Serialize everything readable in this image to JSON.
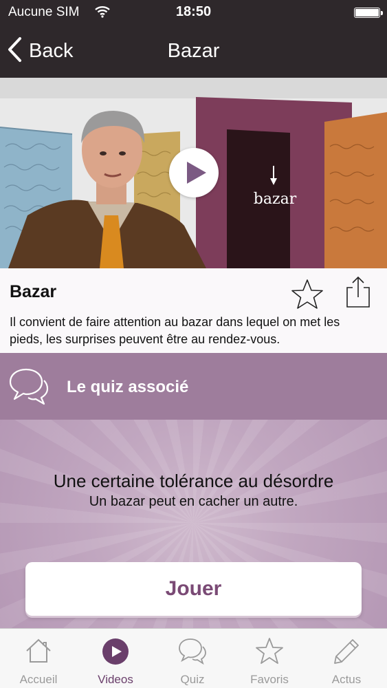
{
  "status": {
    "carrier": "Aucune SIM",
    "time": "18:50"
  },
  "nav": {
    "back_label": "Back",
    "title": "Bazar"
  },
  "video": {
    "overlay_word": "bazar"
  },
  "info": {
    "title": "Bazar",
    "description": "Il convient de faire attention au bazar dans lequel on met les pieds, les surprises peuvent être au rendez-vous."
  },
  "quiz": {
    "header_label": "Le quiz associé",
    "title": "Une certaine tolérance au désordre",
    "subtitle": "Un bazar peut en cacher un autre.",
    "play_label": "Jouer"
  },
  "tabs": [
    {
      "label": "Accueil",
      "icon": "home-icon"
    },
    {
      "label": "Videos",
      "icon": "play-circle-icon",
      "active": true
    },
    {
      "label": "Quiz",
      "icon": "chat-bubbles-icon"
    },
    {
      "label": "Favoris",
      "icon": "star-icon"
    },
    {
      "label": "Actus",
      "icon": "pencil-icon"
    }
  ],
  "colors": {
    "bar_dark": "#2e282b",
    "accent_purple": "#6a3f6b",
    "quiz_header": "#9e7d9c",
    "play_text": "#7a4a75"
  }
}
